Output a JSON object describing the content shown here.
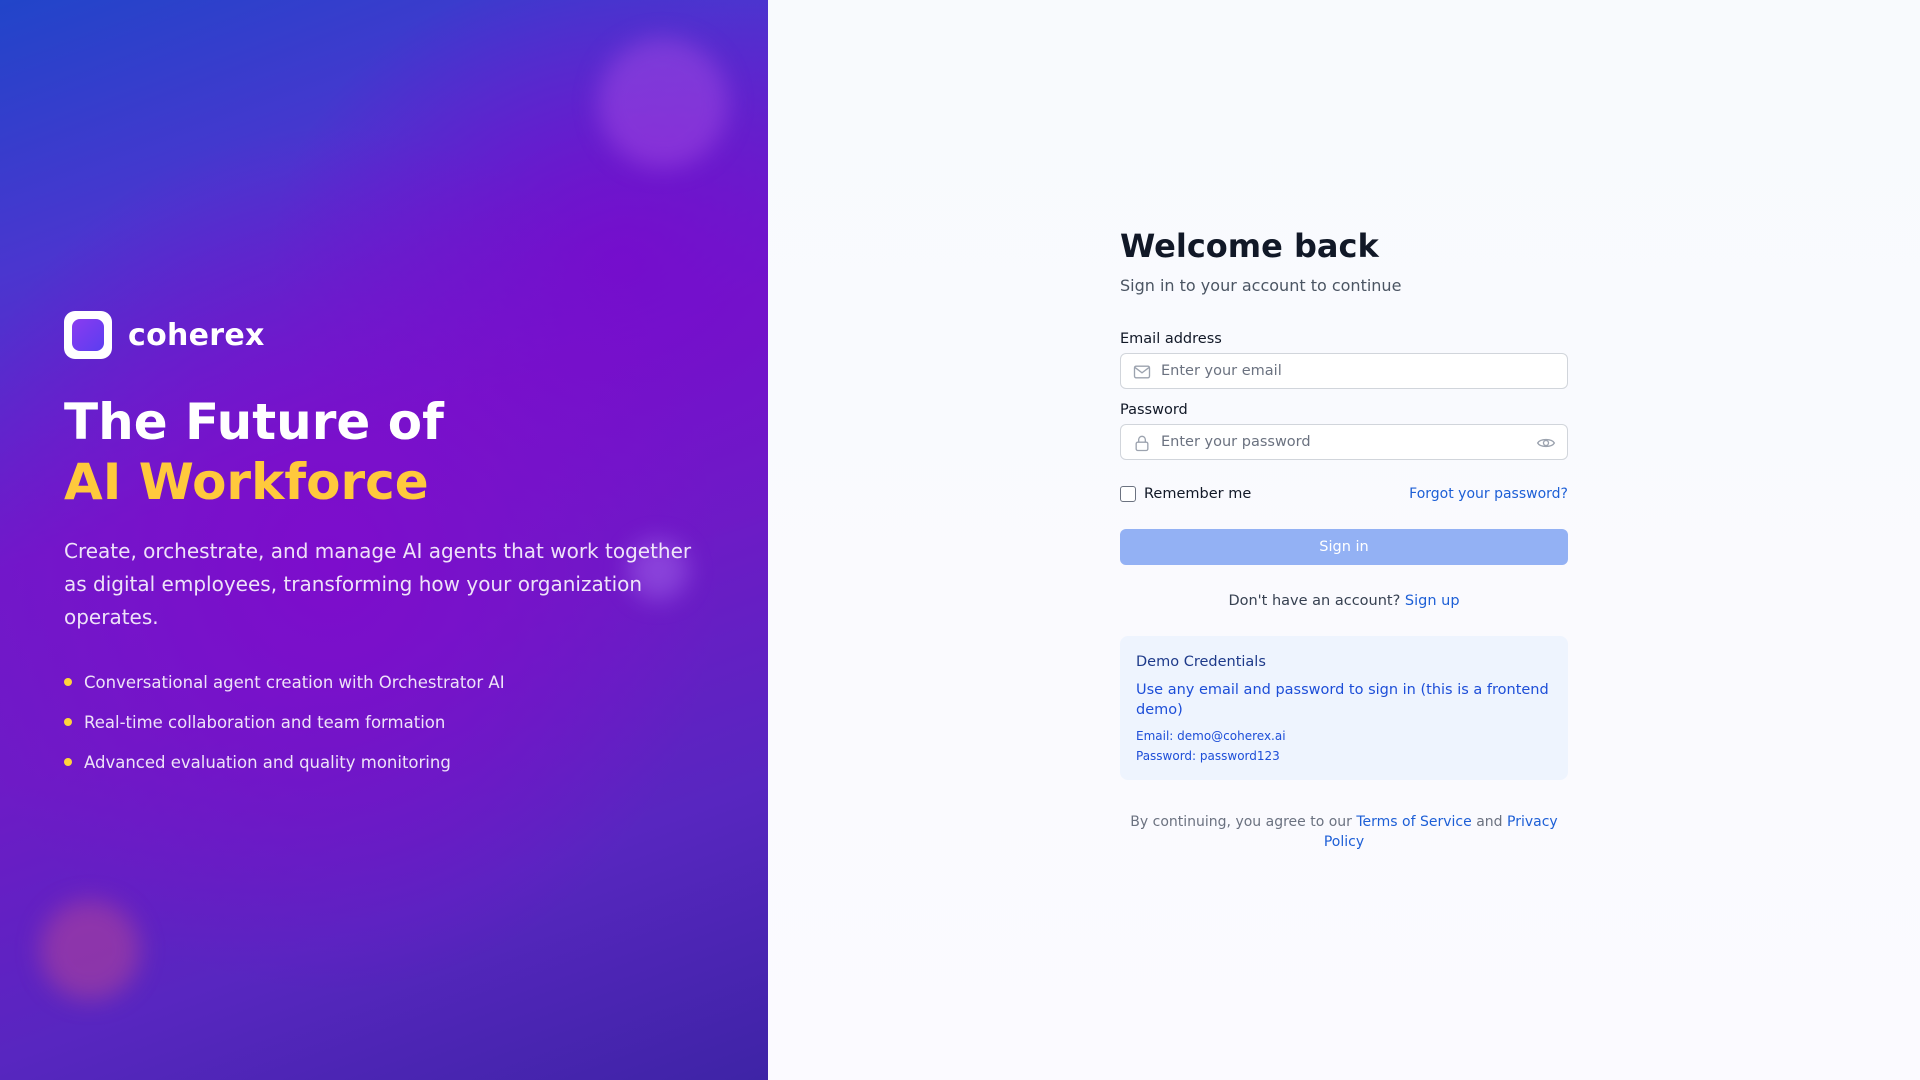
{
  "hero": {
    "brand_name": "coherex",
    "headline_line1": "The Future of",
    "headline_line2": "AI Workforce",
    "tagline": "Create, orchestrate, and manage AI agents that work together as digital employees, transforming how your organization operates.",
    "features": [
      "Conversational agent creation with Orchestrator AI",
      "Real-time collaboration and team formation",
      "Advanced evaluation and quality monitoring"
    ]
  },
  "signin": {
    "title": "Welcome back",
    "subtitle": "Sign in to your account to continue",
    "email_label": "Email address",
    "email_placeholder": "Enter your email",
    "email_value": "",
    "password_label": "Password",
    "password_placeholder": "Enter your password",
    "password_value": "",
    "remember_label": "Remember me",
    "remember_checked": false,
    "forgot_label": "Forgot your password?",
    "submit_label": "Sign in",
    "no_account_text": "Don't have an account?",
    "signup_label": "Sign up"
  },
  "demo": {
    "title": "Demo Credentials",
    "description": "Use any email and password to sign in (this is a frontend demo)",
    "email_line": "Email: demo@coherex.ai",
    "password_line": "Password: password123"
  },
  "legal": {
    "prefix": "By continuing, you agree to our",
    "terms_label": "Terms of Service",
    "conjunction": "and",
    "privacy_label": "Privacy Policy"
  },
  "icons": {
    "logo": "coherex-logo-icon",
    "email": "mail-icon",
    "password": "lock-icon",
    "toggle_password": "eye-icon",
    "feature_bullet": "dot-icon"
  },
  "colors": {
    "accent_yellow": "#ffc93c",
    "bullet_yellow": "#ffd43b",
    "link_blue": "#1d5fd6",
    "button_blue": "#93b1f4",
    "demo_bg": "#eef4fe",
    "hero_purple": "#7019c9",
    "hero_blue": "#2145c9"
  }
}
